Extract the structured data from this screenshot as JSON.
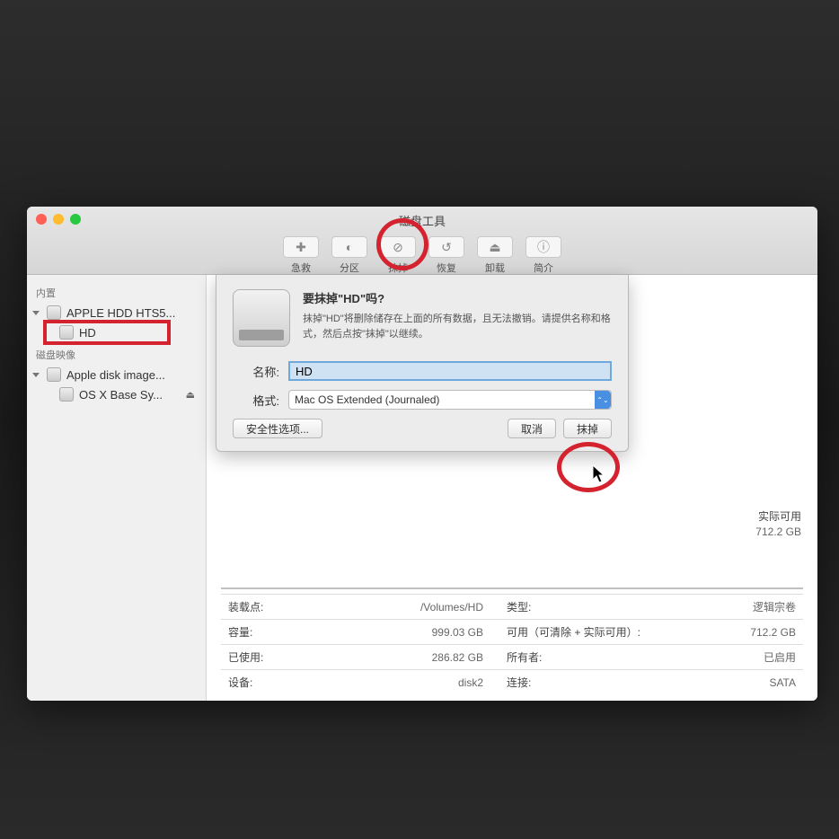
{
  "window": {
    "title": "磁盘工具"
  },
  "toolbar": {
    "first_aid": "急救",
    "partition": "分区",
    "erase": "抹掉",
    "restore": "恢复",
    "unmount": "卸载",
    "info": "简介"
  },
  "sidebar": {
    "internal_header": "内置",
    "disk0": "APPLE HDD HTS5...",
    "disk0_vol": "HD",
    "images_header": "磁盘映像",
    "image0": "Apple disk image...",
    "image0_vol": "OS X Base Sy..."
  },
  "dialog": {
    "title": "要抹掉\"HD\"吗?",
    "body": "抹掉\"HD\"将删除储存在上面的所有数据，且无法撤销。请提供名称和格式，然后点按\"抹掉\"以继续。",
    "name_label": "名称:",
    "name_value": "HD",
    "format_label": "格式:",
    "format_value": "Mac OS Extended (Journaled)",
    "security_btn": "安全性选项...",
    "cancel_btn": "取消",
    "erase_btn": "抹掉"
  },
  "side_stats": {
    "label": "实际可用",
    "value": "712.2 GB"
  },
  "info": {
    "mount_k": "装载点:",
    "mount_v": "/Volumes/HD",
    "type_k": "类型:",
    "type_v": "逻辑宗卷",
    "capacity_k": "容量:",
    "capacity_v": "999.03 GB",
    "avail_k": "可用（可清除 + 实际可用）:",
    "avail_v": "712.2 GB",
    "used_k": "已使用:",
    "used_v": "286.82 GB",
    "owner_k": "所有者:",
    "owner_v": "已启用",
    "device_k": "设备:",
    "device_v": "disk2",
    "conn_k": "连接:",
    "conn_v": "SATA"
  }
}
